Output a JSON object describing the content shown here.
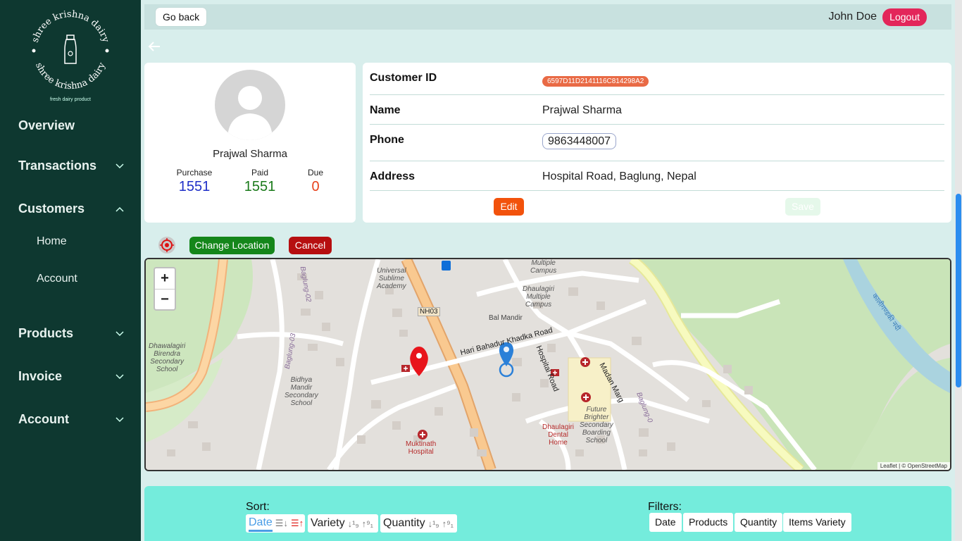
{
  "brand": {
    "name_top": "shree krishna dairy",
    "name_bottom": "shree krishna dairy",
    "tagline": "fresh dairy product"
  },
  "sidebar": {
    "items": [
      {
        "label": "Overview",
        "has_chevron": false
      },
      {
        "label": "Transactions",
        "has_chevron": true,
        "chevron": "down"
      },
      {
        "label": "Customers",
        "has_chevron": true,
        "chevron": "up"
      },
      {
        "label": "Products",
        "has_chevron": true,
        "chevron": "down"
      },
      {
        "label": "Invoice",
        "has_chevron": true,
        "chevron": "down"
      },
      {
        "label": "Account",
        "has_chevron": true,
        "chevron": "down"
      }
    ],
    "sub_items": [
      {
        "label": "Home"
      },
      {
        "label": "Account"
      }
    ]
  },
  "topbar": {
    "go_back": "Go back",
    "user": "John Doe",
    "logout": "Logout"
  },
  "profile": {
    "name": "Prajwal Sharma",
    "purchase_label": "Purchase",
    "purchase": "1551",
    "paid_label": "Paid",
    "paid": "1551",
    "due_label": "Due",
    "due": "0"
  },
  "details": {
    "customer_id_label": "Customer ID",
    "customer_id": "6597D11D2141116C814298A2",
    "name_label": "Name",
    "name": "Prajwal Sharma",
    "phone_label": "Phone",
    "phone": "9863448007",
    "address_label": "Address",
    "address": "Hospital Road, Baglung, Nepal",
    "edit": "Edit",
    "save": "Save"
  },
  "location": {
    "change": "Change Location",
    "cancel": "Cancel"
  },
  "map": {
    "zoom_in": "+",
    "zoom_out": "−",
    "attribution": "Leaflet | © OpenStreetMap",
    "labels": {
      "universal": "Universal\nSublime\nAcademy",
      "multiple_campus": "Multiple\nCampus",
      "dhaulagiri_multiple": "Dhaulagiri\nMultiple\nCampus",
      "nh03": "NH03",
      "bal_mandir": "Bal Mandir",
      "hari_road": "Hari Bahadur Khadka Road",
      "hospital_road": "Hospital Road",
      "madan_marg": "Madan Marg",
      "dhawalagiri": "Dhawalagiri\nBirendra\nSecondary\nSchool",
      "bidhya": "Bidhya\nMandir\nSecondary\nSchool",
      "future": "Future\nBrighter\nSecondary\nBoarding\nSchool",
      "muktinath": "Muktinath\nHospital",
      "dental": "Dhaulagiri\nDental\nHome",
      "baglung02": "Baglung-02",
      "baglung03": "Baglung-03",
      "baglung04": "Baglung-0",
      "river": "कालीगण्डकी नदी"
    }
  },
  "sort": {
    "title": "Sort:",
    "date": "Date",
    "variety": "Variety",
    "quantity": "Quantity"
  },
  "filters": {
    "title": "Filters:",
    "chips": [
      "Date",
      "Products",
      "Quantity",
      "Items Variety"
    ]
  },
  "colors": {
    "sidebar": "#0e3830",
    "logout": "#e3265a",
    "purchase": "#1f2fc8",
    "paid": "#1a7a1a",
    "due": "#e8421c",
    "panel": "#74ecdc"
  }
}
